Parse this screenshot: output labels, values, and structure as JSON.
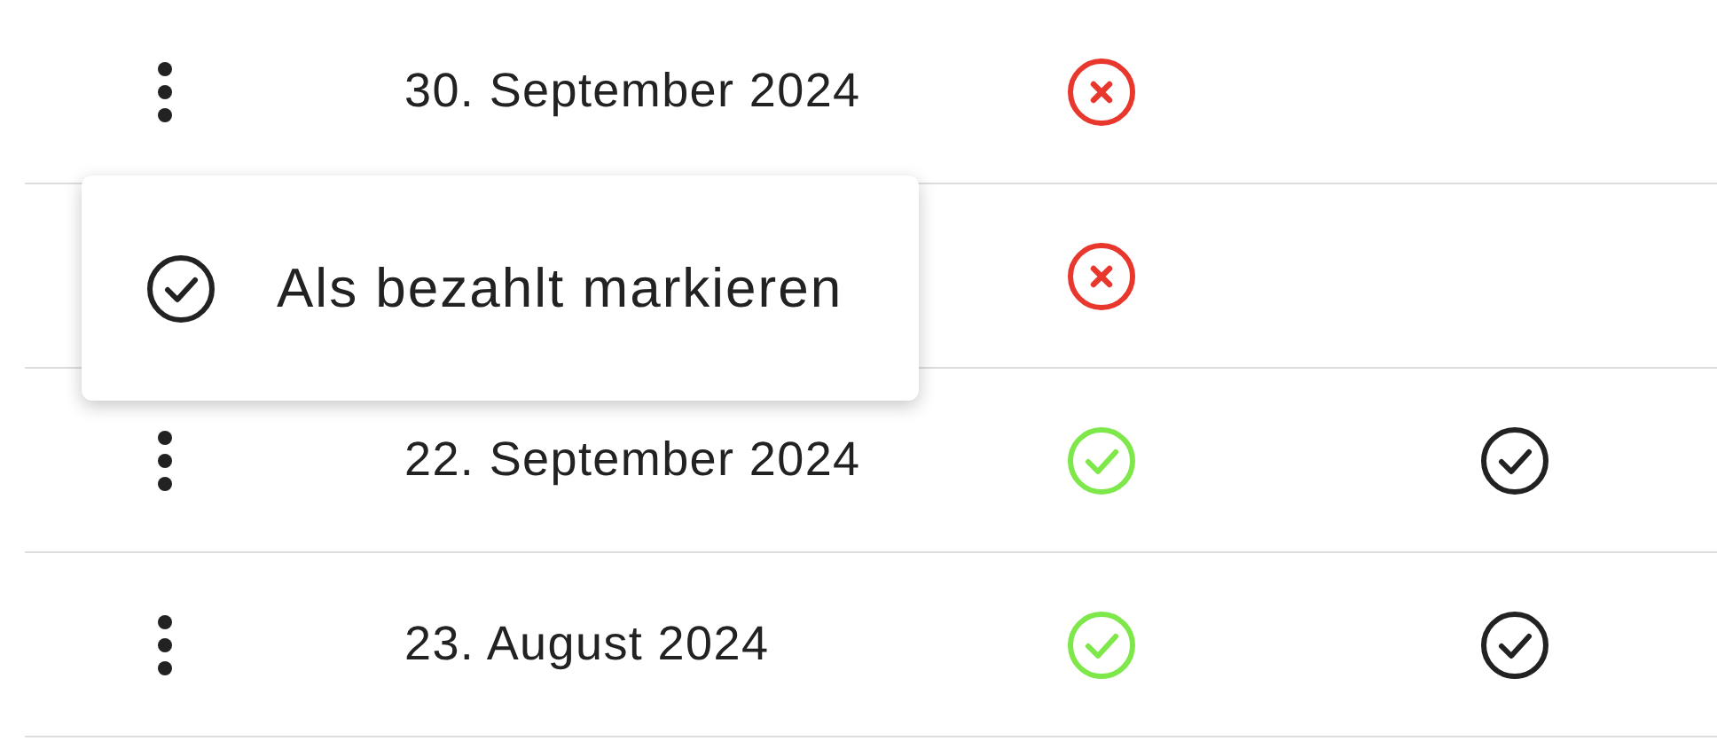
{
  "rows": [
    {
      "date": "30. September 2024",
      "paid": false,
      "marked": false
    },
    {
      "paid": false,
      "marked": false
    },
    {
      "date": "22. September 2024",
      "paid": true,
      "marked": true
    },
    {
      "date": "23. August 2024",
      "paid": true,
      "marked": true
    }
  ],
  "menu": {
    "items": [
      {
        "label": "Als bezahlt markieren"
      }
    ]
  }
}
